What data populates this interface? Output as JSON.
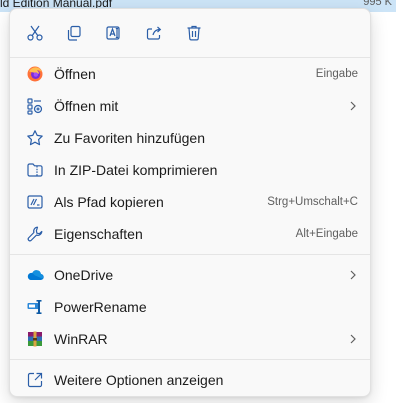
{
  "background_row": {
    "file_name": "ld Edition Manual.pdf",
    "file_size": "995 K"
  },
  "toolbar": {
    "buttons": [
      {
        "name": "cut-button",
        "icon": "scissors-icon"
      },
      {
        "name": "copy-button",
        "icon": "copy-icon"
      },
      {
        "name": "rename-button",
        "icon": "rename-icon"
      },
      {
        "name": "share-button",
        "icon": "share-icon"
      },
      {
        "name": "delete-button",
        "icon": "trash-icon"
      }
    ]
  },
  "menu": {
    "items": [
      {
        "label": "Öffnen",
        "shortcut": "Eingabe",
        "icon": "firefox-icon"
      },
      {
        "label": "Öffnen mit",
        "submenu": true,
        "icon": "open-with-icon"
      },
      {
        "label": "Zu Favoriten hinzufügen",
        "icon": "star-icon"
      },
      {
        "label": "In ZIP-Datei komprimieren",
        "icon": "zip-folder-icon"
      },
      {
        "label": "Als Pfad kopieren",
        "shortcut": "Strg+Umschalt+C",
        "icon": "copy-path-icon"
      },
      {
        "label": "Eigenschaften",
        "shortcut": "Alt+Eingabe",
        "icon": "wrench-icon"
      },
      {
        "label": "OneDrive",
        "submenu": true,
        "icon": "onedrive-icon"
      },
      {
        "label": "PowerRename",
        "icon": "powerrename-icon"
      },
      {
        "label": "WinRAR",
        "submenu": true,
        "icon": "winrar-icon"
      },
      {
        "label": "Weitere Optionen anzeigen",
        "icon": "show-more-icon"
      }
    ]
  },
  "colors": {
    "accent": "#0067c0",
    "firefox_orange": "#ff7139",
    "onedrive_blue": "#0078d4"
  }
}
